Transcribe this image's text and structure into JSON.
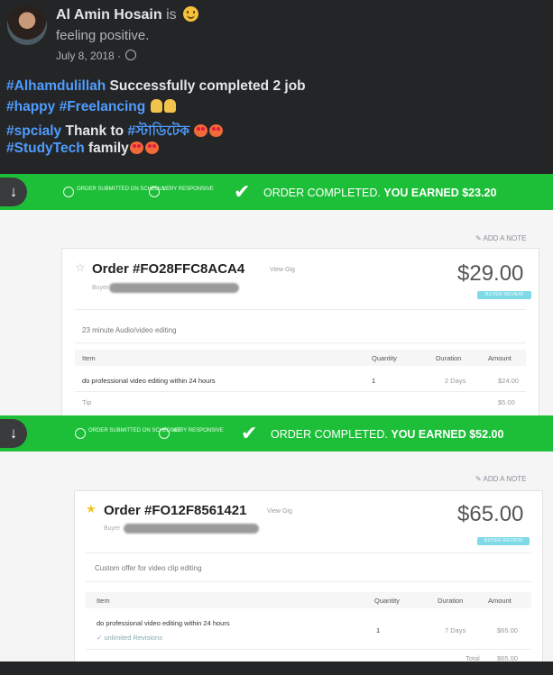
{
  "post": {
    "author": "Al Amin Hosain",
    "is_word": "is",
    "feeling": "feeling positive.",
    "date": "July 8, 2018 ·",
    "lines": [
      {
        "tag": "#Alhamdulillah",
        "text": " Successfully completed 2 job"
      },
      {
        "tag": "#happy #Freelancing",
        "text": ""
      },
      {
        "tag": "#spcialy",
        "text": " Thank to ",
        "tag2": "#স্টাডিটেক"
      },
      {
        "tag": "#StudyTech",
        "text": " family"
      }
    ]
  },
  "orders": [
    {
      "banner_badge1": "ORDER SUBMITTED ON SCHEDULE",
      "banner_badge2": "VERY RESPONSIVE",
      "banner_main": "ORDER COMPLETED.",
      "banner_earned": "YOU EARNED $23.20",
      "add_review": "ADD A NOTE",
      "order_number": "Order #FO28FFC8ACA4",
      "view_by": "View Gig",
      "buyer_label": "Buyer",
      "total_amount": "$29.00",
      "status": "BUYER REVIEW",
      "description": "23 minute Audio/video editing",
      "table": {
        "headers": [
          "Item",
          "Quantity",
          "Duration",
          "Amount"
        ],
        "rows": [
          [
            "do professional video editing within 24 hours",
            "1",
            "2 Days",
            "$24.00"
          ],
          [
            "Tip",
            "",
            "",
            "$5.00"
          ]
        ]
      }
    },
    {
      "banner_badge1": "ORDER SUBMITTED ON SCHEDULE",
      "banner_badge2": "VERY RESPONSIVE",
      "banner_main": "ORDER COMPLETED.",
      "banner_earned": "YOU EARNED $52.00",
      "add_review": "ADD A NOTE",
      "order_number": "Order #FO12F8561421",
      "view_by": "View Gig",
      "buyer_label": "Buyer",
      "total_amount": "$65.00",
      "status": "BUYER REVIEW",
      "description": "Custom offer for video clip editing",
      "table": {
        "headers": [
          "Item",
          "Quantity",
          "Duration",
          "Amount"
        ],
        "rows": [
          [
            "do professional video editing within 24 hours",
            "1",
            "7 Days",
            "$65.00"
          ],
          [
            "✓ unlimited Revisions",
            "",
            "",
            ""
          ],
          [
            "",
            "",
            "Total",
            "$65.00"
          ]
        ]
      }
    }
  ]
}
